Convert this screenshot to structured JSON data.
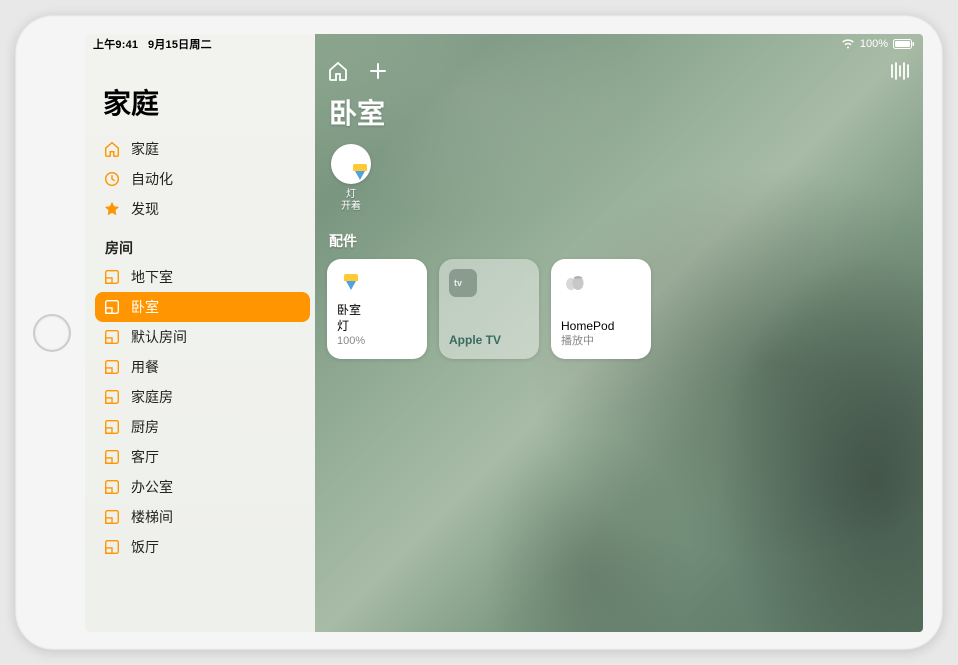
{
  "status_bar": {
    "time": "上午9:41",
    "date": "9月15日周二",
    "battery": "100%"
  },
  "sidebar": {
    "title": "家庭",
    "main_items": [
      {
        "label": "家庭",
        "icon": "home"
      },
      {
        "label": "自动化",
        "icon": "clock"
      },
      {
        "label": "发现",
        "icon": "star"
      }
    ],
    "rooms_header": "房间",
    "rooms": [
      {
        "label": "地下室"
      },
      {
        "label": "卧室",
        "selected": true
      },
      {
        "label": "默认房间"
      },
      {
        "label": "用餐"
      },
      {
        "label": "家庭房"
      },
      {
        "label": "厨房"
      },
      {
        "label": "客厅"
      },
      {
        "label": "办公室"
      },
      {
        "label": "楼梯间"
      },
      {
        "label": "饭厅"
      }
    ]
  },
  "main": {
    "title": "卧室",
    "status": {
      "line1": "灯",
      "line2": "开着"
    },
    "accessories_header": "配件",
    "tiles": [
      {
        "line1": "卧室",
        "line2": "灯",
        "sub": "100%",
        "variant": "white",
        "icon": "lamp"
      },
      {
        "line1": "Apple TV",
        "line2": "",
        "sub": "",
        "variant": "glass",
        "icon": "appletv"
      },
      {
        "line1": "HomePod",
        "line2": "",
        "sub": "播放中",
        "variant": "white",
        "icon": "homepod"
      }
    ]
  }
}
